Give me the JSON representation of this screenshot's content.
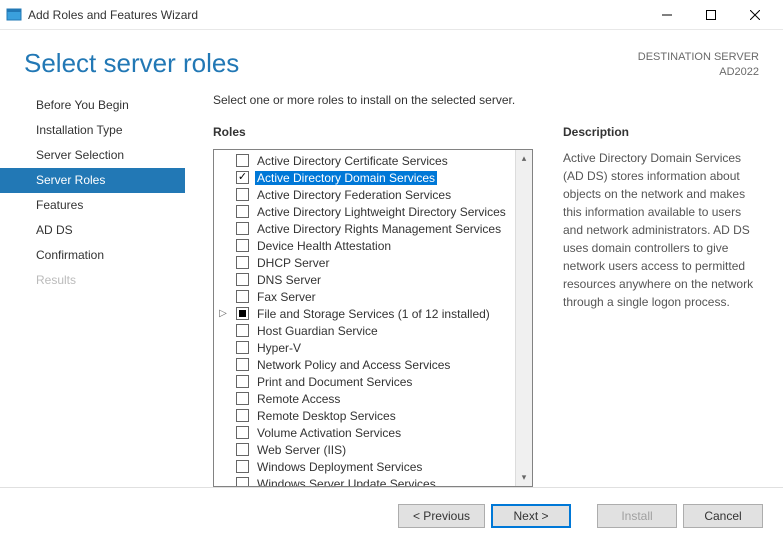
{
  "window": {
    "title": "Add Roles and Features Wizard"
  },
  "header": {
    "pageTitle": "Select server roles",
    "destLabel": "DESTINATION SERVER",
    "destValue": "AD2022"
  },
  "sidebar": {
    "items": [
      {
        "label": "Before You Begin",
        "state": "normal"
      },
      {
        "label": "Installation Type",
        "state": "normal"
      },
      {
        "label": "Server Selection",
        "state": "normal"
      },
      {
        "label": "Server Roles",
        "state": "selected"
      },
      {
        "label": "Features",
        "state": "normal"
      },
      {
        "label": "AD DS",
        "state": "normal"
      },
      {
        "label": "Confirmation",
        "state": "normal"
      },
      {
        "label": "Results",
        "state": "disabled"
      }
    ]
  },
  "main": {
    "instruction": "Select one or more roles to install on the selected server.",
    "rolesLabel": "Roles",
    "descLabel": "Description",
    "descText": "Active Directory Domain Services (AD DS) stores information about objects on the network and makes this information available to users and network administrators. AD DS uses domain controllers to give network users access to permitted resources anywhere on the network through a single logon process.",
    "roles": [
      {
        "label": "Active Directory Certificate Services",
        "chk": "none"
      },
      {
        "label": "Active Directory Domain Services",
        "chk": "checked",
        "highlight": true
      },
      {
        "label": "Active Directory Federation Services",
        "chk": "none"
      },
      {
        "label": "Active Directory Lightweight Directory Services",
        "chk": "none"
      },
      {
        "label": "Active Directory Rights Management Services",
        "chk": "none"
      },
      {
        "label": "Device Health Attestation",
        "chk": "none"
      },
      {
        "label": "DHCP Server",
        "chk": "none"
      },
      {
        "label": "DNS Server",
        "chk": "none"
      },
      {
        "label": "Fax Server",
        "chk": "none"
      },
      {
        "label": "File and Storage Services (1 of 12 installed)",
        "chk": "indet",
        "expander": true
      },
      {
        "label": "Host Guardian Service",
        "chk": "none"
      },
      {
        "label": "Hyper-V",
        "chk": "none"
      },
      {
        "label": "Network Policy and Access Services",
        "chk": "none"
      },
      {
        "label": "Print and Document Services",
        "chk": "none"
      },
      {
        "label": "Remote Access",
        "chk": "none"
      },
      {
        "label": "Remote Desktop Services",
        "chk": "none"
      },
      {
        "label": "Volume Activation Services",
        "chk": "none"
      },
      {
        "label": "Web Server (IIS)",
        "chk": "none"
      },
      {
        "label": "Windows Deployment Services",
        "chk": "none"
      },
      {
        "label": "Windows Server Update Services",
        "chk": "none"
      }
    ]
  },
  "footer": {
    "previous": "< Previous",
    "next": "Next >",
    "install": "Install",
    "cancel": "Cancel"
  }
}
